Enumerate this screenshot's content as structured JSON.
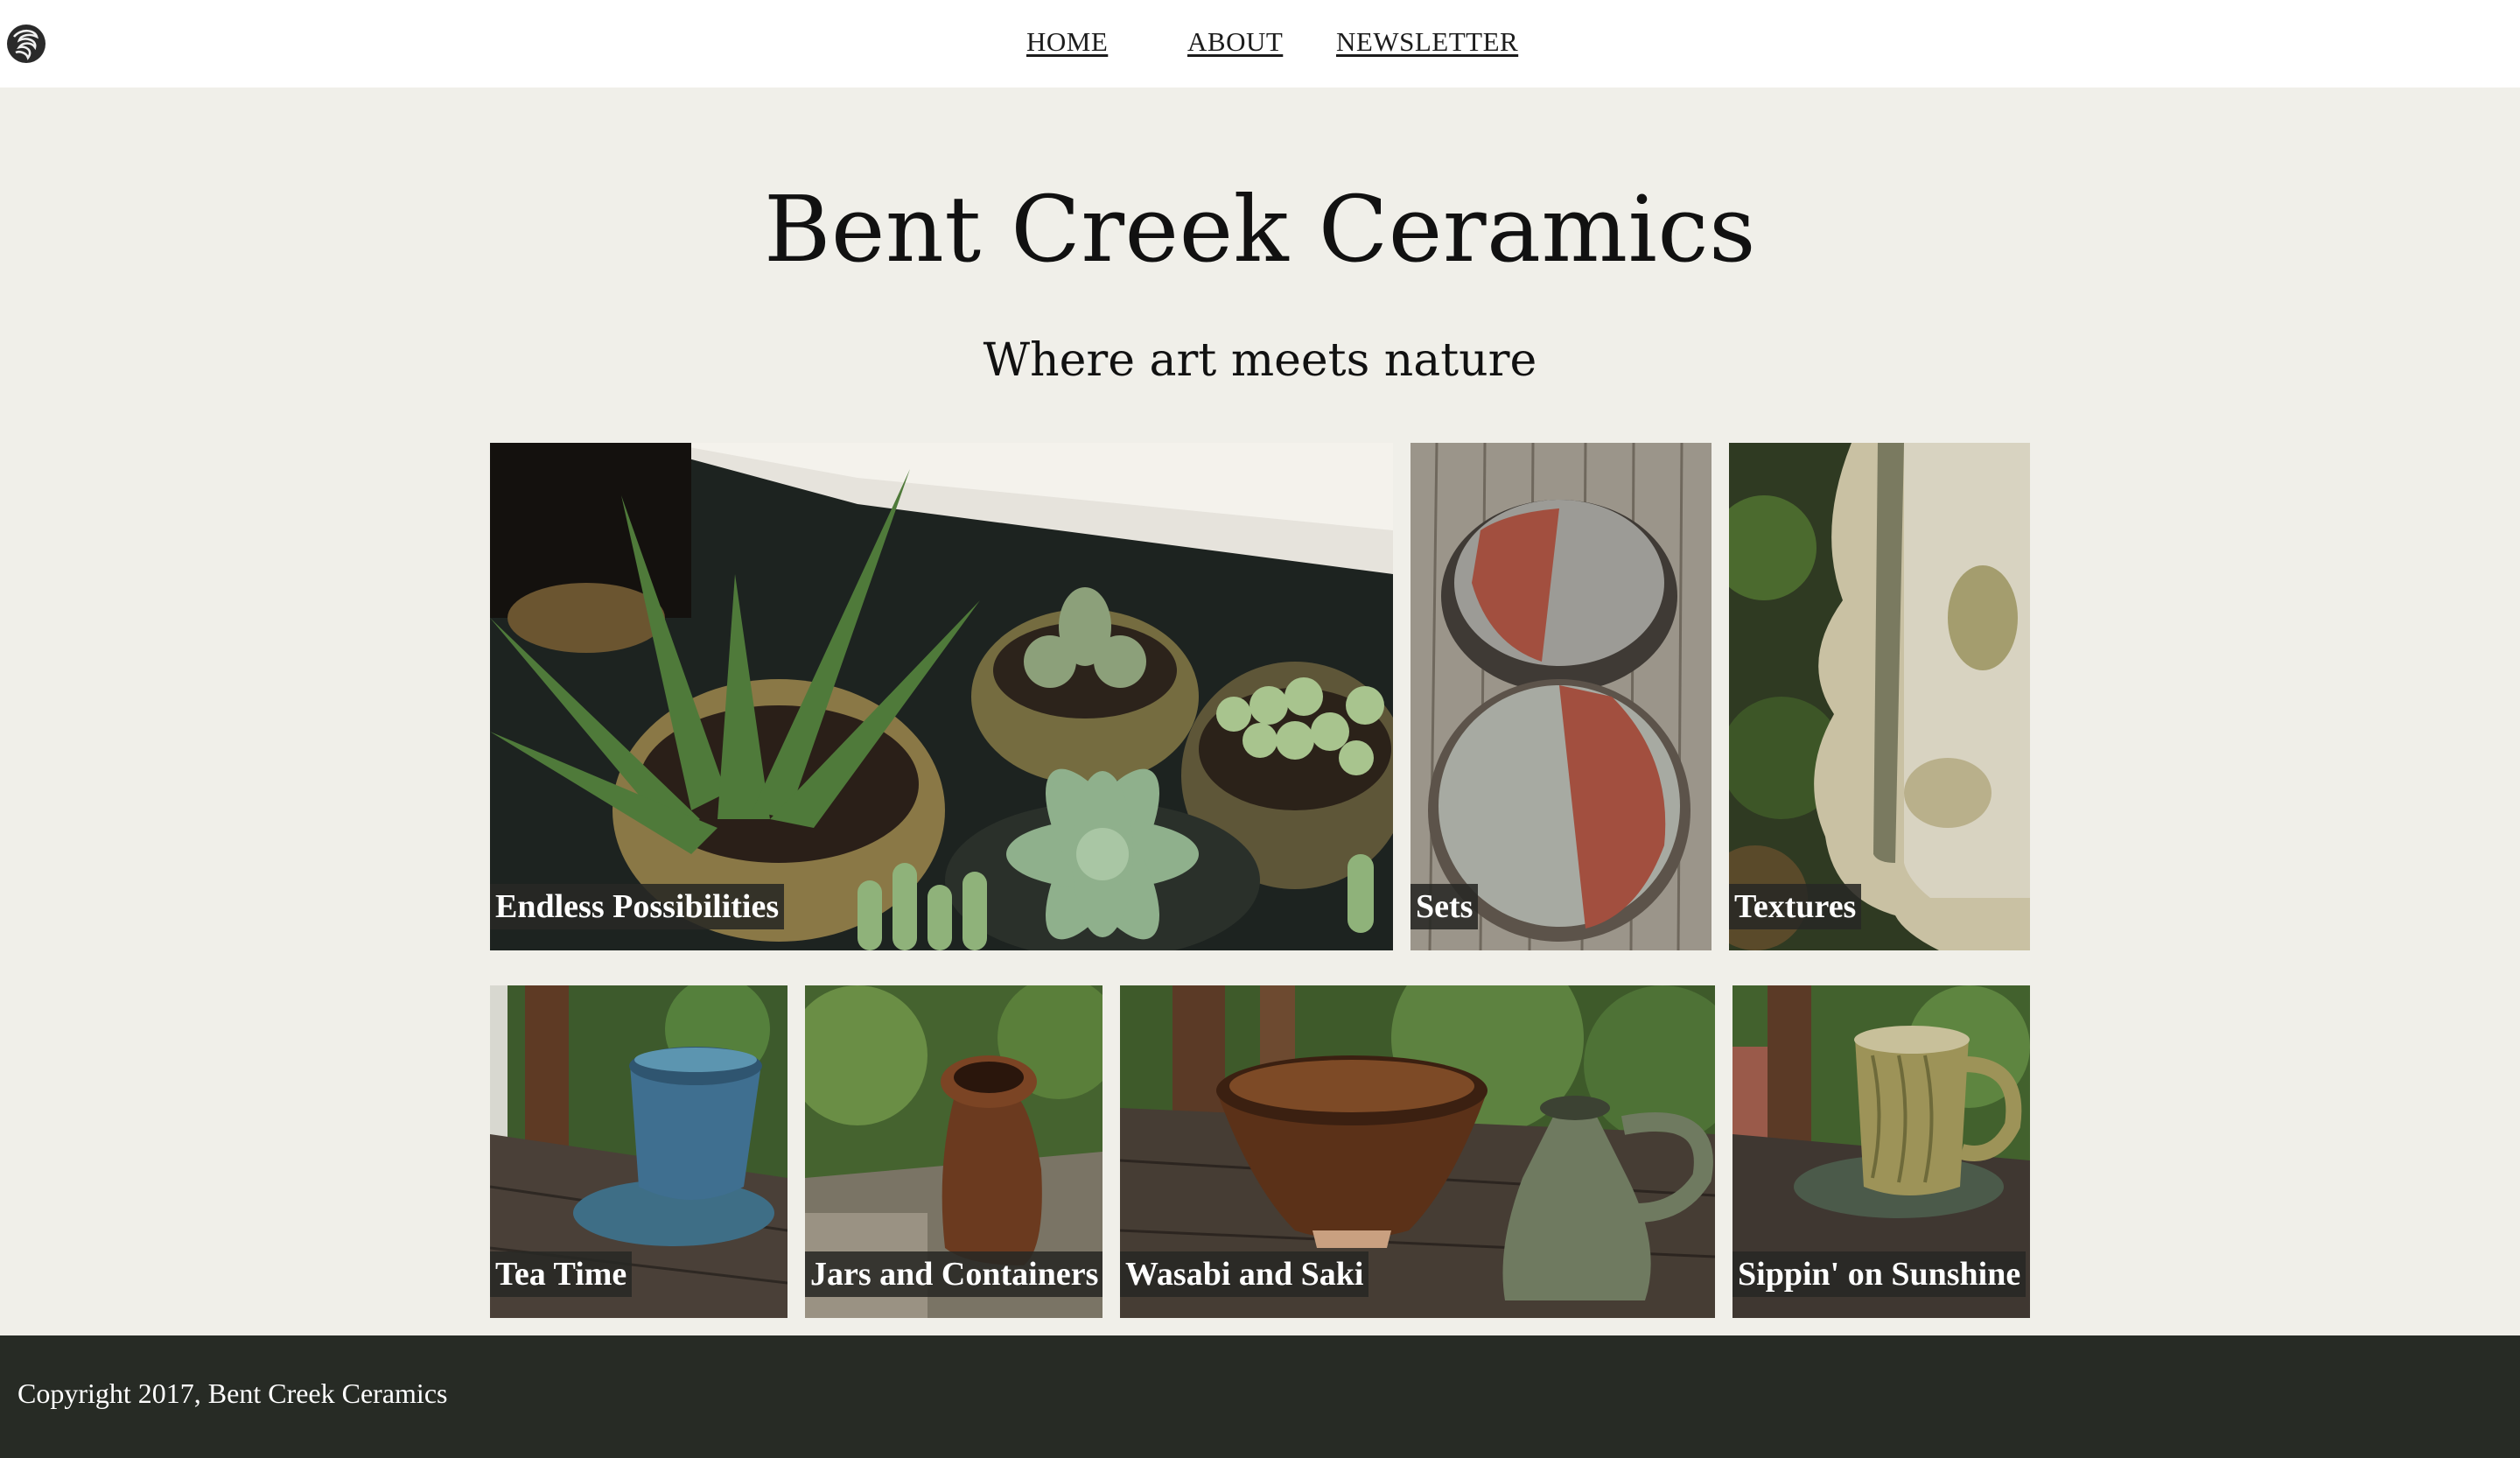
{
  "header": {
    "logo_icon": "swirl-logo-icon",
    "nav": [
      {
        "label": "HOME"
      },
      {
        "label": "ABOUT"
      },
      {
        "label": "NEWSLETTER"
      }
    ]
  },
  "hero": {
    "title": "Bent Creek Ceramics",
    "subtitle": "Where art meets nature"
  },
  "gallery": {
    "tiles": [
      {
        "caption": "Endless Possibilities"
      },
      {
        "caption": "Sets"
      },
      {
        "caption": "Textures"
      },
      {
        "caption": "Tea Time"
      },
      {
        "caption": "Jars and Containers"
      },
      {
        "caption": "Wasabi and Saki"
      },
      {
        "caption": "Sippin' on Sunshine"
      }
    ]
  },
  "footer": {
    "copyright": "Copyright 2017, Bent Creek Ceramics"
  },
  "colors": {
    "page_background": "#f0efe9",
    "header_background": "#ffffff",
    "footer_background": "#272b25",
    "caption_background": "#282824"
  }
}
